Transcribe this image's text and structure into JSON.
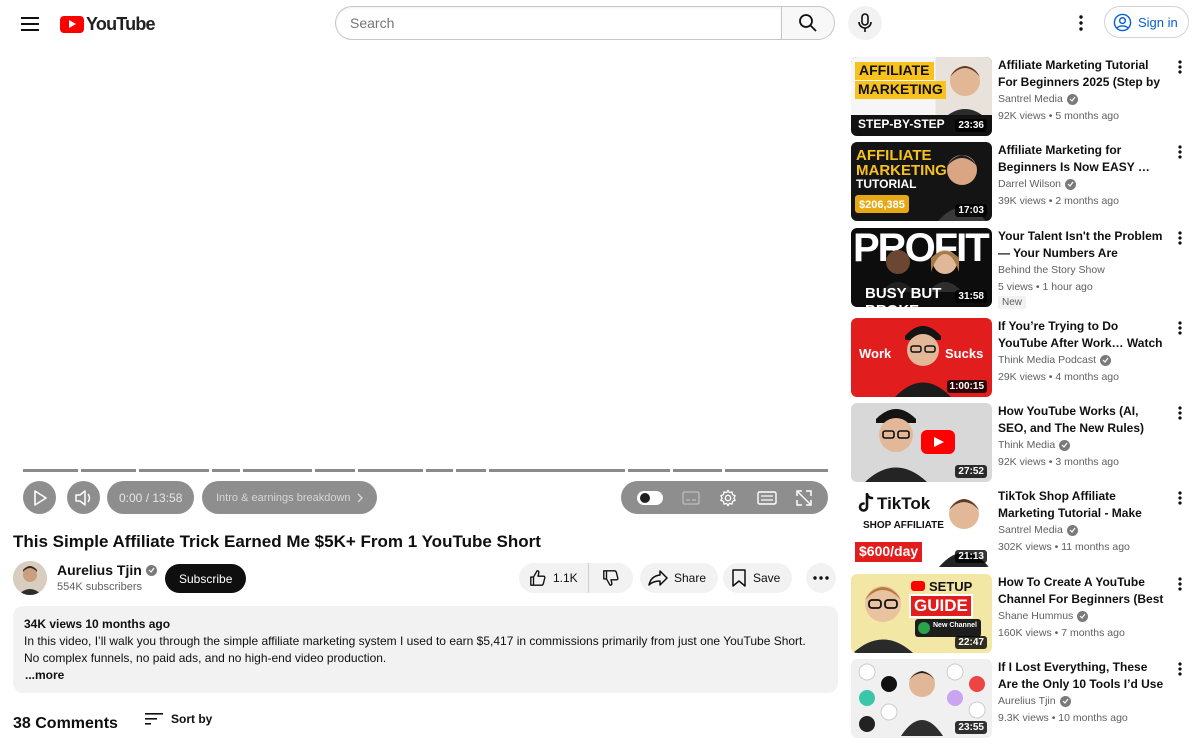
{
  "header": {
    "logo_text": "YouTube",
    "search_placeholder": "Search",
    "signin_label": "Sign in"
  },
  "player": {
    "current_time": "0:00 / 13:58",
    "chapter": "Intro & earnings breakdown",
    "progress": 0.0
  },
  "video": {
    "title": "This Simple Affiliate Trick Earned Me $5K+ From 1 YouTube Short",
    "channel_name": "Aurelius Tjin",
    "subscribers": "554K subscribers",
    "subscribe_label": "Subscribe",
    "likes": "1.1K",
    "share_label": "Share",
    "save_label": "Save",
    "views_date": "34K views  10 months ago",
    "description": "In this video, I’ll walk you through the simple affiliate marketing system I used to earn $5,417 in commissions primarily from just one YouTube Short. No complex funnels, no paid ads, and no high-end video production.",
    "more_label": "...more"
  },
  "comments": {
    "count_label": "38 Comments",
    "sort_label": "Sort by"
  },
  "recommendations": [
    {
      "title": "Affiliate Marketing Tutorial For Beginners 2025 (Step by Step)",
      "channel": "Santrel Media",
      "verified": true,
      "meta": "92K views • 5 months ago",
      "duration": "23:36",
      "thumb_text": [
        "AFFILIATE",
        "MARKETING",
        "STEP-BY-STEP"
      ]
    },
    {
      "title": "Affiliate Marketing for Beginners Is Now EASY …",
      "channel": "Darrel Wilson",
      "verified": true,
      "meta": "39K views • 2 months ago",
      "duration": "17:03",
      "thumb_text": [
        "AFFILIATE",
        "MARKETING",
        "TUTORIAL",
        "$206,385"
      ]
    },
    {
      "title": "Your Talent Isn't the Problem — Your Numbers Are",
      "channel": "Behind the Story Show",
      "verified": false,
      "meta": "5 views • 1 hour ago",
      "duration": "31:58",
      "badge": "New",
      "thumb_text": [
        "PROFIT",
        "BUSY BUT BROKE"
      ]
    },
    {
      "title": "If You’re Trying to Do YouTube After Work… Watch This",
      "channel": "Think Media Podcast",
      "verified": true,
      "meta": "29K views • 4 months ago",
      "duration": "1:00:15",
      "thumb_text": [
        "Work",
        "Sucks"
      ]
    },
    {
      "title": "How YouTube Works (AI, SEO, and The New Rules)",
      "channel": "Think Media",
      "verified": true,
      "meta": "92K views • 3 months ago",
      "duration": "27:52",
      "thumb_text": []
    },
    {
      "title": "TikTok Shop Affiliate Marketing Tutorial - Make Money on Tiktok",
      "channel": "Santrel Media",
      "verified": true,
      "meta": "302K views • 11 months ago",
      "duration": "21:13",
      "thumb_text": [
        "TikTok",
        "SHOP AFFILIATE",
        "$600/day"
      ]
    },
    {
      "title": "How To Create A YouTube Channel For Beginners (Best …",
      "channel": "Shane Hummus",
      "verified": true,
      "meta": "160K views • 7 months ago",
      "duration": "22:47",
      "thumb_text": [
        "SETUP",
        "GUIDE",
        "New Channel"
      ]
    },
    {
      "title": "If I Lost Everything, These Are the Only 10 Tools I’d Use",
      "channel": "Aurelius Tjin",
      "verified": true,
      "meta": "9.3K views • 10 months ago",
      "duration": "23:55",
      "thumb_text": []
    }
  ],
  "colors": {
    "brand_red": "#ff0000",
    "link_blue": "#065fd4",
    "text_primary": "#0f0f0f",
    "text_secondary": "#606060"
  }
}
